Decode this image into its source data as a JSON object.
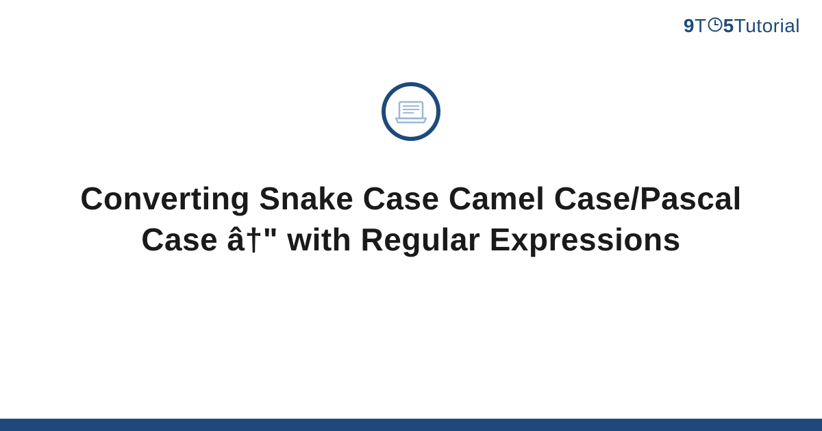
{
  "logo": {
    "nine": "9",
    "t": "T",
    "five": "5",
    "tutorial": "Tutorial"
  },
  "title": "Converting Snake Case Camel Case/Pascal Case â†\" with Regular Expressions",
  "colors": {
    "brand": "#1d4a7a",
    "text": "#1a1a1a",
    "iconLight": "#9db8d8"
  }
}
